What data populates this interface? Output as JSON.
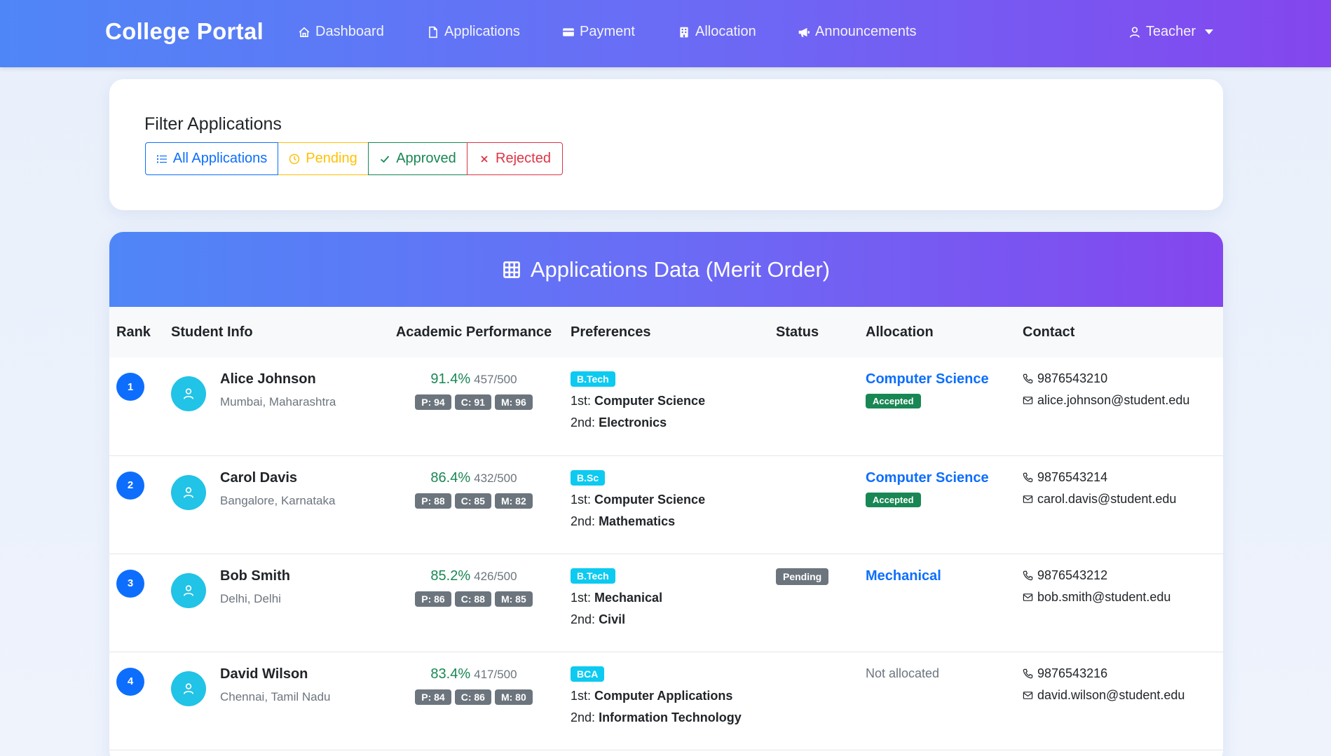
{
  "nav": {
    "brand": "College Portal",
    "items": [
      {
        "label": "Dashboard",
        "icon": "house-icon"
      },
      {
        "label": "Applications",
        "icon": "file-icon"
      },
      {
        "label": "Payment",
        "icon": "credit-card-icon"
      },
      {
        "label": "Allocation",
        "icon": "building-icon"
      },
      {
        "label": "Announcements",
        "icon": "megaphone-icon"
      }
    ],
    "user": "Teacher"
  },
  "filter": {
    "title": "Filter Applications",
    "buttons": {
      "all": "All Applications",
      "pending": "Pending",
      "approved": "Approved",
      "rejected": "Rejected"
    }
  },
  "table": {
    "title": "Applications Data (Merit Order)",
    "columns": [
      "Rank",
      "Student Info",
      "Academic Performance",
      "Preferences",
      "Status",
      "Allocation",
      "Contact"
    ],
    "rows": [
      {
        "rank": "1",
        "name": "Alice Johnson",
        "location": "Mumbai, Maharashtra",
        "percent": "91.4%",
        "marks": "457/500",
        "p": "P: 94",
        "c": "C: 91",
        "m": "M: 96",
        "course": "B.Tech",
        "pref1_label": "1st:",
        "pref1": "Computer Science",
        "pref2_label": "2nd:",
        "pref2": "Electronics",
        "status": "",
        "allocation": "Computer Science",
        "allocation_status": "Accepted",
        "phone": "9876543210",
        "email": "alice.johnson@student.edu"
      },
      {
        "rank": "2",
        "name": "Carol Davis",
        "location": "Bangalore, Karnataka",
        "percent": "86.4%",
        "marks": "432/500",
        "p": "P: 88",
        "c": "C: 85",
        "m": "M: 82",
        "course": "B.Sc",
        "pref1_label": "1st:",
        "pref1": "Computer Science",
        "pref2_label": "2nd:",
        "pref2": "Mathematics",
        "status": "",
        "allocation": "Computer Science",
        "allocation_status": "Accepted",
        "phone": "9876543214",
        "email": "carol.davis@student.edu"
      },
      {
        "rank": "3",
        "name": "Bob Smith",
        "location": "Delhi, Delhi",
        "percent": "85.2%",
        "marks": "426/500",
        "p": "P: 86",
        "c": "C: 88",
        "m": "M: 85",
        "course": "B.Tech",
        "pref1_label": "1st:",
        "pref1": "Mechanical",
        "pref2_label": "2nd:",
        "pref2": "Civil",
        "status": "Pending",
        "allocation": "Mechanical",
        "allocation_status": "",
        "phone": "9876543212",
        "email": "bob.smith@student.edu"
      },
      {
        "rank": "4",
        "name": "David Wilson",
        "location": "Chennai, Tamil Nadu",
        "percent": "83.4%",
        "marks": "417/500",
        "p": "P: 84",
        "c": "C: 86",
        "m": "M: 80",
        "course": "BCA",
        "pref1_label": "1st:",
        "pref1": "Computer Applications",
        "pref2_label": "2nd:",
        "pref2": "Information Technology",
        "status": "",
        "allocation": "Not allocated",
        "allocation_status": "",
        "phone": "9876543216",
        "email": "david.wilson@student.edu"
      }
    ]
  },
  "colors": {
    "primary": "#0d6efd",
    "success": "#198754",
    "warning": "#ffc107",
    "danger": "#dc3545",
    "info": "#0dcaf0",
    "secondary": "#6c757d",
    "gradient_start": "#4f86f7",
    "gradient_end": "#8446ee"
  }
}
